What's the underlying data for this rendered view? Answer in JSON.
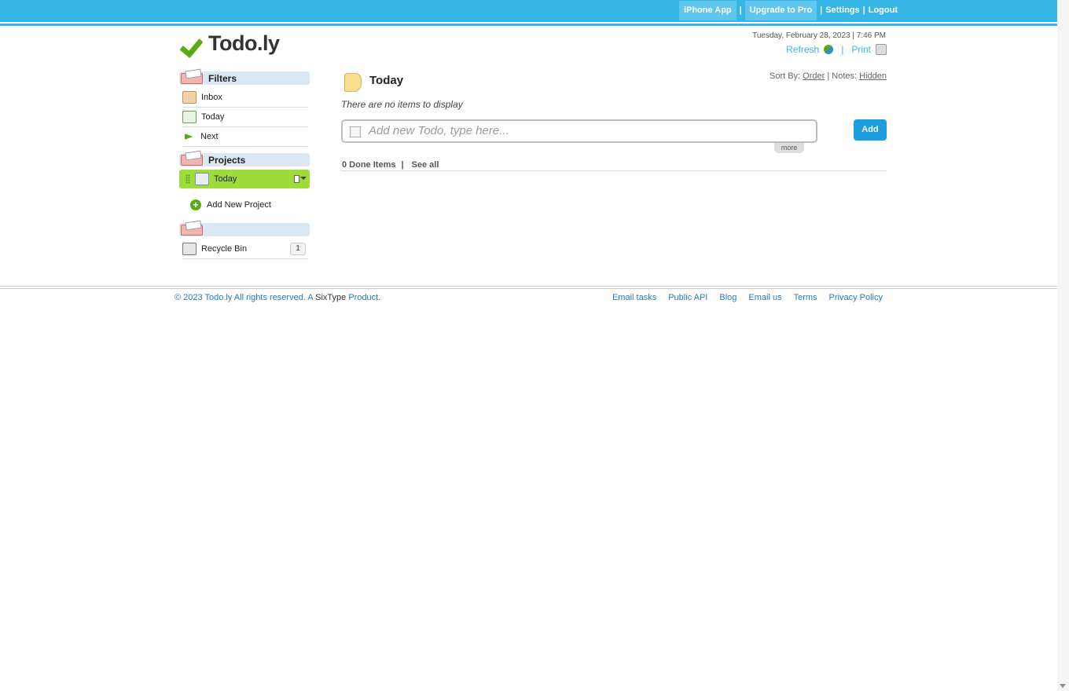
{
  "topnav": {
    "iphone_app": "iPhone App",
    "upgrade": "Upgrade to Pro",
    "settings": "Settings",
    "logout": "Logout",
    "sep": "|"
  },
  "header": {
    "logo_text": "Todo.ly",
    "datetime": "Tuesday, February 28, 2023 | 7:46 PM",
    "refresh": "Refresh",
    "print": "Print",
    "sep": "|"
  },
  "sidebar": {
    "filters_title": "Filters",
    "filters": [
      {
        "label": "Inbox",
        "icon": "inbox-icon"
      },
      {
        "label": "Today",
        "icon": "today-icon"
      },
      {
        "label": "Next",
        "icon": "next-arrow-icon"
      }
    ],
    "projects_title": "Projects",
    "projects": [
      {
        "label": "Today",
        "icon": "calendar-icon"
      }
    ],
    "add_project": "Add New Project",
    "extra_title": "",
    "recycle_bin": {
      "label": "Recycle Bin",
      "count": "1"
    }
  },
  "main": {
    "title": "Today",
    "sort_by_label": "Sort By:",
    "sort_by_value": "Order",
    "notes_label": "| Notes:",
    "notes_value": "Hidden",
    "empty_message": "There are no items to display",
    "input_placeholder": "Add new Todo, type here...",
    "add_button": "Add",
    "more_button": "more",
    "done_items": "0 Done Items",
    "see_all": "See all"
  },
  "footer": {
    "copyright_prefix": "© 2023 Todo.ly All rights reserved. A ",
    "sixtype": "SixType",
    "copyright_suffix": " Product.",
    "links": [
      "Email tasks",
      "Public API",
      "Blog",
      "Email us",
      "Terms",
      "Privacy Policy"
    ]
  },
  "colors": {
    "accent": "#36b5e7",
    "active_project": "#9edc3c",
    "add_button": "#1a9ee0"
  }
}
